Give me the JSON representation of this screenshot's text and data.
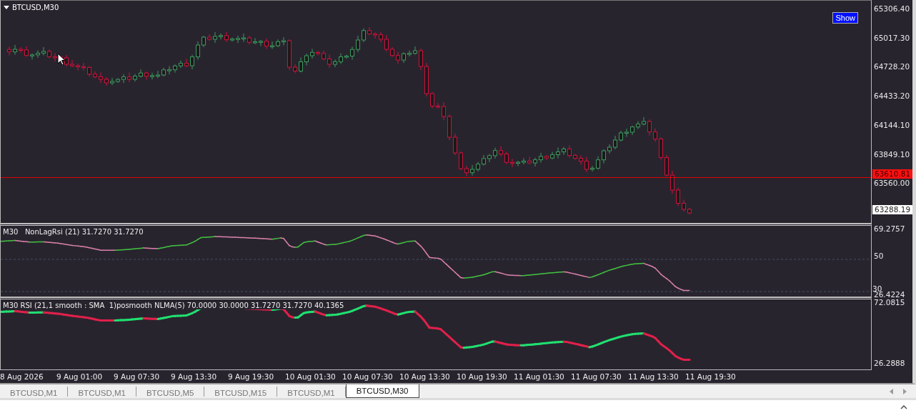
{
  "chart": {
    "title": "BTCUSD,M30",
    "show_button": "Show",
    "price_axis": [
      "65306.40",
      "65017.30",
      "64728.20",
      "64433.20",
      "64144.10",
      "63849.10",
      "63560.00"
    ],
    "price_markers": [
      {
        "kind": "line",
        "value": "63610.81"
      },
      {
        "kind": "box",
        "value": "63288.19"
      }
    ]
  },
  "indicators": [
    {
      "label": "M30   NonLagRsi (21) 31.7270 31.7270",
      "axis": [
        "69.2757",
        "50",
        "30",
        "26.4224"
      ],
      "kind": "thin"
    },
    {
      "label": "M30 RSI (21,1 smooth : SMA  1)posmooth NLMA(5) 70.0000 30.0000 31.7270 31.7270 40.1365",
      "axis": [
        "72.0815",
        "26.2888"
      ],
      "kind": "thick"
    }
  ],
  "time_axis": [
    "8 Aug 2026",
    "9 Aug 01:00",
    "9 Aug 07:30",
    "9 Aug 13:30",
    "9 Aug 19:30",
    "10 Aug 01:30",
    "10 Aug 07:30",
    "10 Aug 13:30",
    "10 Aug 19:30",
    "11 Aug 01:30",
    "11 Aug 07:30",
    "11 Aug 13:30",
    "11 Aug 19:30"
  ],
  "tabs": [
    {
      "label": "BTCUSD,M1",
      "selected": false
    },
    {
      "label": "BTCUSD,M1",
      "selected": false
    },
    {
      "label": "BTCUSD,M5",
      "selected": false
    },
    {
      "label": "BTCUSD,M15",
      "selected": false
    },
    {
      "label": "BTCUSD,M1",
      "selected": false
    },
    {
      "label": "BTCUSD,M30",
      "selected": true
    }
  ]
}
